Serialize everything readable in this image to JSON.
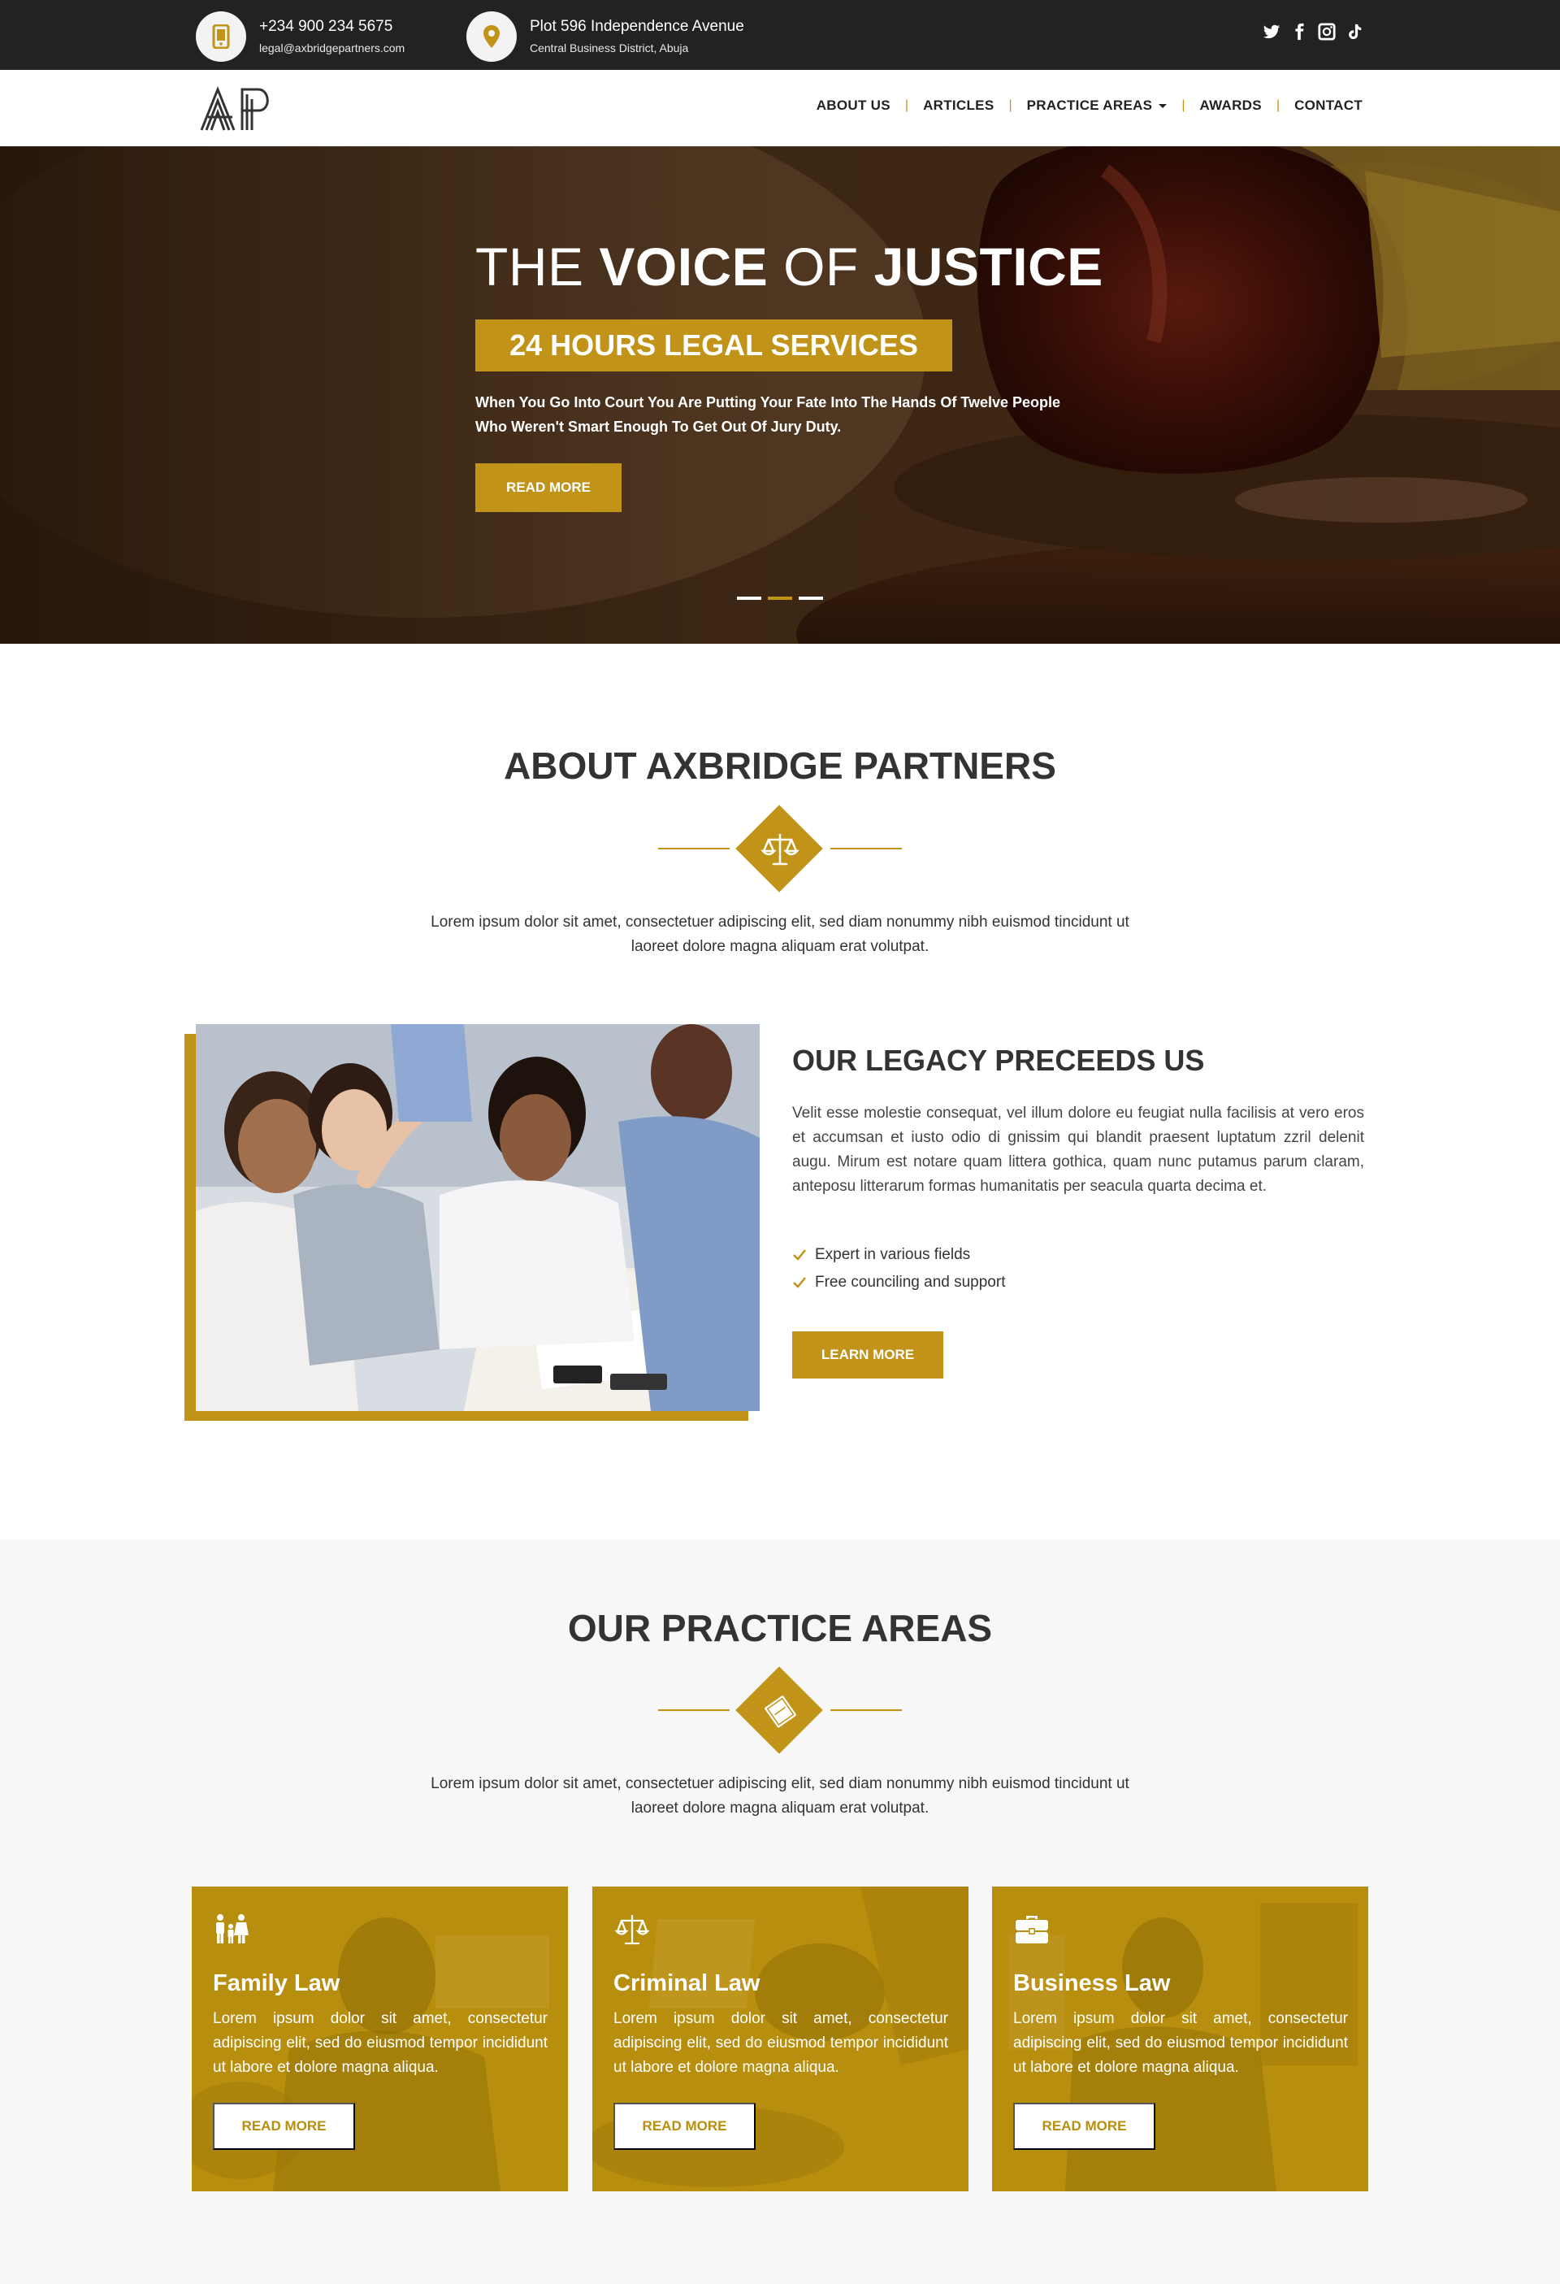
{
  "colors": {
    "accent": "#c19419",
    "topbar": "#222222",
    "section_bg": "#f7f7f7"
  },
  "topbar": {
    "phone": "+234 900 234 5675",
    "email": "legal@axbridgepartners.com",
    "address": "Plot 596 Independence Avenue",
    "district": "Central Business District, Abuja",
    "social": [
      "twitter-icon",
      "facebook-icon",
      "instagram-icon",
      "tiktok-icon"
    ]
  },
  "nav": {
    "logo_text": "AP",
    "items": [
      "ABOUT US",
      "ARTICLES",
      "PRACTICE AREAS",
      "AWARDS",
      "CONTACT"
    ]
  },
  "hero": {
    "title_light1": "THE ",
    "title_bold1": "VOICE",
    "title_light2": " OF ",
    "title_bold2": "JUSTICE",
    "badge": "24 HOURS LEGAL SERVICES",
    "text": "When You Go Into Court You Are Putting Your Fate Into The Hands Of Twelve People Who Weren't Smart Enough To Get Out Of Jury Duty.",
    "button": "READ MORE",
    "active_slide": 2,
    "slide_count": 3
  },
  "about": {
    "title_light": "ABOUT ",
    "title_bold": "AXBRIDGE PARTNERS",
    "icon": "scales-icon",
    "text": "Lorem ipsum dolor sit amet, consectetuer adipiscing elit, sed diam nonummy nibh euismod tincidunt ut laoreet dolore magna aliquam erat volutpat."
  },
  "legacy": {
    "title": "OUR LEGACY PRECEEDS US",
    "text": "Velit esse molestie consequat, vel illum dolore eu feugiat nulla facilisis at vero eros et accumsan et iusto odio di gnissim qui blandit praesent luptatum zzril delenit augu. Mirum est notare quam littera gothica, quam nunc putamus parum claram, anteposu litterarum formas humanitatis per seacula quarta decima et.",
    "checks": [
      "Expert in various fields",
      "Free counciling and support"
    ],
    "button": "LEARN MORE"
  },
  "practice": {
    "title_light": "OUR ",
    "title_bold": "PRACTICE AREAS",
    "icon": "law-book-icon",
    "text": "Lorem ipsum dolor sit amet, consectetuer adipiscing elit, sed diam nonummy nibh euismod tincidunt ut laoreet dolore magna aliquam erat volutpat.",
    "cards": [
      {
        "icon": "family-icon",
        "title": "Family Law",
        "text": "Lorem ipsum dolor sit amet, consectetur adipiscing elit, sed do eiusmod tempor incididunt ut labore et dolore magna aliqua.",
        "button": "READ MORE"
      },
      {
        "icon": "scales-icon",
        "title": "Criminal Law",
        "text": "Lorem ipsum dolor sit amet, consectetur adipiscing elit, sed do eiusmod tempor incididunt ut labore et dolore magna aliqua.",
        "button": "READ MORE"
      },
      {
        "icon": "briefcase-icon",
        "title": "Business Law",
        "text": "Lorem ipsum dolor sit amet, consectetur adipiscing elit, sed do eiusmod tempor incididunt ut labore et dolore magna aliqua.",
        "button": "READ MORE"
      }
    ]
  }
}
